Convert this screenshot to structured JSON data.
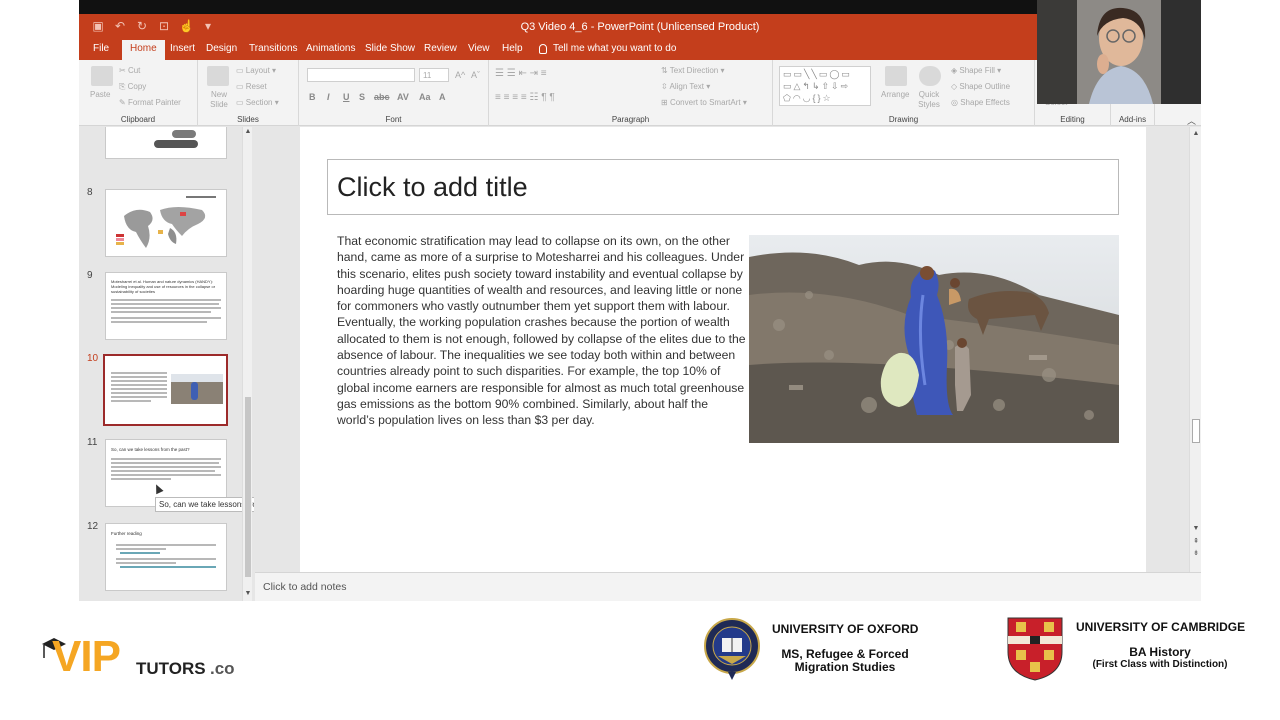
{
  "window": {
    "title": "Q3 Video 4_6  -  PowerPoint (Unlicensed Product)"
  },
  "tabs": [
    "File",
    "Home",
    "Insert",
    "Design",
    "Transitions",
    "Animations",
    "Slide Show",
    "Review",
    "View",
    "Help"
  ],
  "active_tab": "Home",
  "tell_me": "Tell me what you want to do",
  "ribbon": {
    "clipboard": {
      "label": "Clipboard",
      "paste": "Paste",
      "cut": "Cut",
      "copy": "Copy",
      "format_painter": "Format Painter"
    },
    "slides": {
      "label": "Slides",
      "new_slide": "New Slide",
      "layout": "Layout",
      "reset": "Reset",
      "section": "Section"
    },
    "font": {
      "label": "Font",
      "size": "11"
    },
    "paragraph": {
      "label": "Paragraph",
      "text_direction": "Text Direction",
      "align_text": "Align Text",
      "smartart": "Convert to SmartArt"
    },
    "drawing": {
      "label": "Drawing",
      "arrange": "Arrange",
      "quick_styles": "Quick Styles",
      "shape_fill": "Shape Fill",
      "shape_outline": "Shape Outline",
      "shape_effects": "Shape Effects"
    },
    "editing": {
      "label": "Editing",
      "select": "Select"
    },
    "addins": {
      "label": "Add-ins"
    }
  },
  "thumbnails": [
    {
      "num": "8",
      "title": ""
    },
    {
      "num": "9",
      "title": "Motesharrei et al. Human and nature dynamics (HANDY): Modeling inequality and use of resources in the collapse or sustainability of societies"
    },
    {
      "num": "10",
      "title": ""
    },
    {
      "num": "11",
      "title": "So, can we take lessons from the past?"
    },
    {
      "num": "12",
      "title": "Further reading"
    }
  ],
  "tooltip": "So, can we take lessons from the ...",
  "slide": {
    "title_placeholder": "Click to add title",
    "body": "That economic stratification may lead to collapse on its own, on the other hand, came as more of a surprise to Motesharrei and his colleagues. Under this scenario, elites push society toward instability and eventual collapse by hoarding huge quantities of wealth and resources, and leaving little or none for commoners who vastly outnumber them yet support them with labour. Eventually, the working population crashes because the portion of wealth allocated to them is not enough, followed by collapse of the elites due to the absence of labour. The inequalities we see today both within and between countries already point to such disparities. For example, the top 10% of global income earners are responsible for almost as much total greenhouse gas emissions as the bottom 90% combined. Similarly, about half the world’s population lives on less than $3 per day."
  },
  "notes_placeholder": "Click to add notes",
  "footer": {
    "brand_vip": "VIP",
    "brand_tutors": "TUTORS",
    "brand_co": ".co",
    "oxford_name": "UNIVERSITY OF OXFORD",
    "oxford_degree_1": "MS, Refugee & Forced",
    "oxford_degree_2": "Migration Studies",
    "cambridge_name": "UNIVERSITY OF CAMBRIDGE",
    "cambridge_degree_1": "BA History",
    "cambridge_degree_2": "(First Class with Distinction)"
  },
  "colors": {
    "accent": "#c43e1c",
    "vip_orange": "#f5a623"
  }
}
